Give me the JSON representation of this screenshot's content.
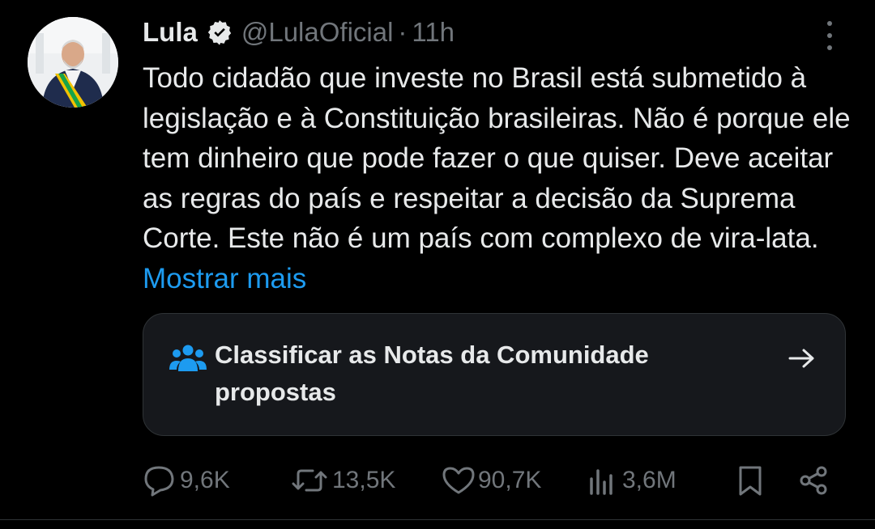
{
  "tweet": {
    "author_name": "Lula",
    "handle": "@LulaOficial",
    "separator": "·",
    "time": "11h",
    "text": "Todo cidadão que investe no Brasil está submetido à legislação e à Constituição brasileiras. Não é porque ele tem dinheiro que pode fazer o que quiser. Deve aceitar as regras do país e respeitar a decisão da Suprema Corte. Este não é um país com complexo de vira-lata.",
    "show_more_label": "Mostrar mais"
  },
  "community_notes": {
    "label": "Classificar as Notas da Comunidade propostas",
    "icon": "people-icon",
    "arrow_icon": "arrow-right-icon"
  },
  "actions": {
    "replies": "9,6K",
    "reposts": "13,5K",
    "likes": "90,7K",
    "views": "3,6M"
  },
  "colors": {
    "background": "#000000",
    "text": "#e7e9ea",
    "secondary": "#71767b",
    "accent": "#1d9bf0",
    "card_background": "#16181c",
    "border": "#2f3336"
  }
}
